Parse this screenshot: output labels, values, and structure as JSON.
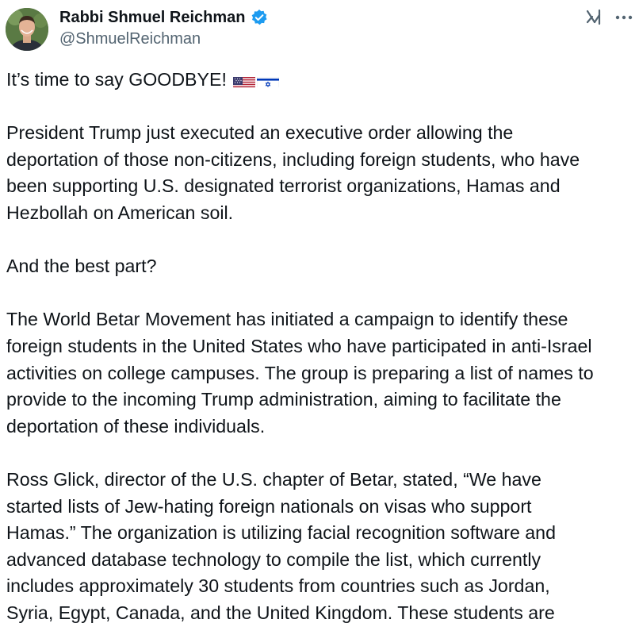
{
  "author": {
    "display_name": "Rabbi Shmuel Reichman",
    "handle": "@ShmuelReichman",
    "verified": true,
    "avatar_icon": "user-avatar-photo"
  },
  "toolbar": {
    "grok_icon": "grok-icon",
    "more_icon": "more-options-icon"
  },
  "post": {
    "line1": "It’s time to say GOODBYE!",
    "flags": [
      "us-flag-icon",
      "israel-flag-icon"
    ],
    "paragraphs": [
      "President Trump just executed an executive order allowing the\ndeportation of those non-citizens, including foreign students, who have\nbeen supporting U.S. designated terrorist organizations, Hamas and\nHezbollah on American soil.",
      "And the best part?",
      "The World Betar Movement has initiated a campaign to identify these\nforeign students in the United States who have participated in anti-Israel\nactivities on college campuses. The group is preparing a list of names to\nprovide to the incoming Trump administration, aiming to facilitate the\ndeportation of these individuals.",
      "Ross Glick, director of the U.S. chapter of Betar, stated, “We have\nstarted lists of Jew-hating foreign nationals on visas who support\nHamas.” The organization is utilizing facial recognition software and\nadvanced database technology to compile the list, which currently\nincludes approximately 30 students from countries such as Jordan,\nSyria, Egypt, Canada, and the United Kingdom. These students are"
    ]
  },
  "colors": {
    "text": "#0f1419",
    "secondary": "#536471",
    "verified_blue": "#1d9bf0"
  }
}
